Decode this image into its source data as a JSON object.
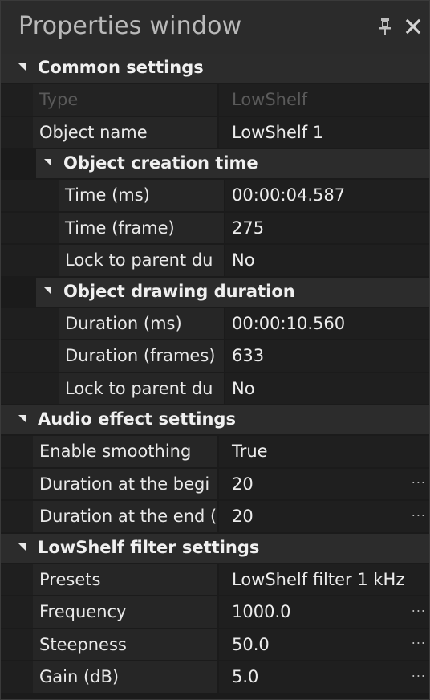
{
  "window": {
    "title": "Properties window",
    "pin_icon": "pin-icon",
    "close_icon": "close-icon"
  },
  "sections": [
    {
      "id": "common",
      "label": "Common settings",
      "rows": [
        {
          "name": "Type",
          "value": "LowShelf",
          "disabled": true
        },
        {
          "name": "Object name",
          "value": "LowShelf 1"
        }
      ],
      "subsections": [
        {
          "id": "creation",
          "label": "Object creation time",
          "rows": [
            {
              "name": "Time (ms)",
              "value": "00:00:04.587"
            },
            {
              "name": "Time (frame)",
              "value": "275"
            },
            {
              "name": "Lock to parent du",
              "value": "No"
            }
          ]
        },
        {
          "id": "drawing",
          "label": "Object drawing duration",
          "rows": [
            {
              "name": "Duration (ms)",
              "value": "00:00:10.560"
            },
            {
              "name": "Duration (frames)",
              "value": "633"
            },
            {
              "name": "Lock to parent du",
              "value": "No"
            }
          ]
        }
      ]
    },
    {
      "id": "audio",
      "label": "Audio effect settings",
      "rows": [
        {
          "name": "Enable smoothing",
          "value": "True"
        },
        {
          "name": "Duration at the begi",
          "value": "20",
          "ellipsis": "..."
        },
        {
          "name": "Duration at the end (",
          "value": "20",
          "ellipsis": "..."
        }
      ]
    },
    {
      "id": "lowshelf",
      "label": "LowShelf filter settings",
      "rows": [
        {
          "name": "Presets",
          "value": "LowShelf filter 1 kHz"
        },
        {
          "name": "Frequency",
          "value": "1000.0",
          "ellipsis": "..."
        },
        {
          "name": "Steepness",
          "value": "50.0",
          "ellipsis": "..."
        },
        {
          "name": "Gain (dB)",
          "value": "5.0",
          "ellipsis": "..."
        }
      ]
    }
  ]
}
